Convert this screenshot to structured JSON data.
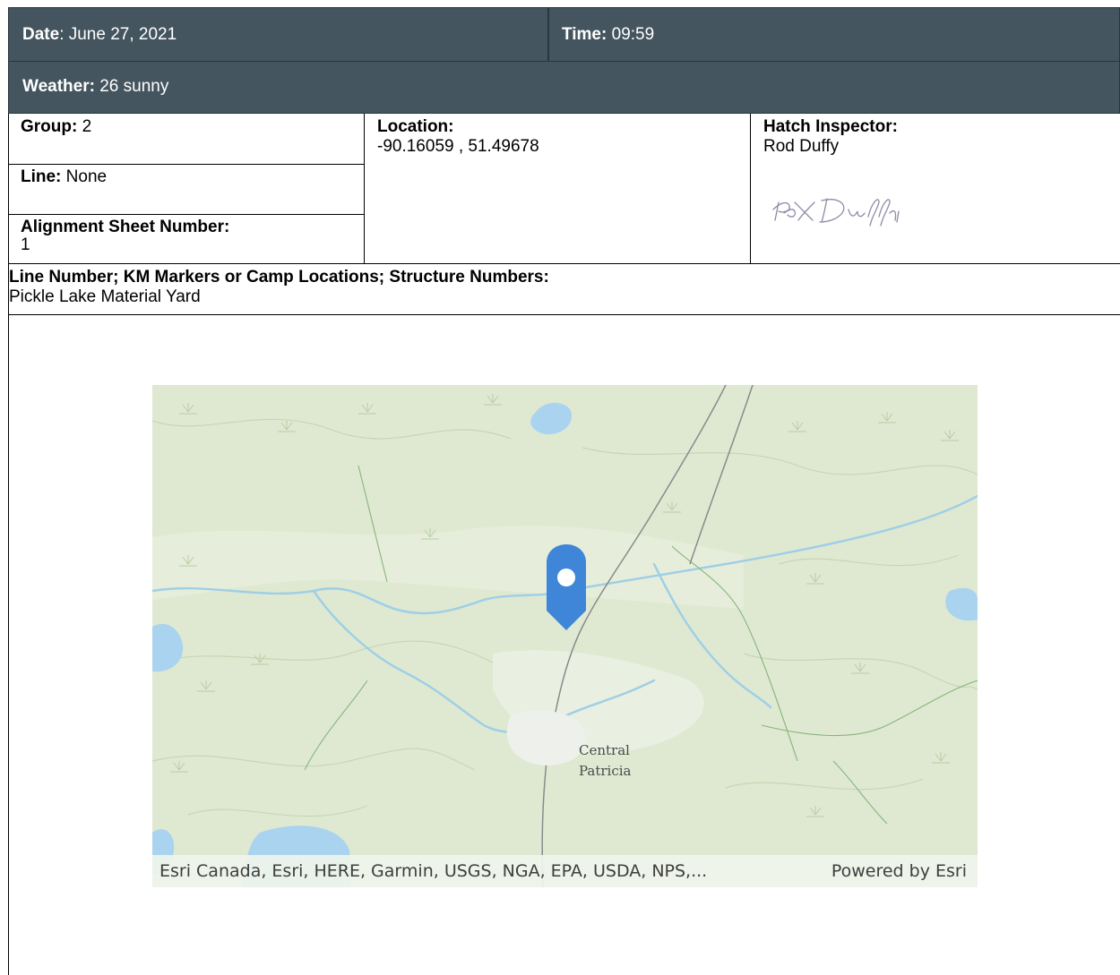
{
  "header": {
    "date_label": "Date",
    "date_value": ": June 27, 2021",
    "time_label": "Time:",
    "time_value": " 09:59",
    "weather_label": "Weather:",
    "weather_value": " 26 sunny"
  },
  "fields": {
    "group_label": "Group:",
    "group_value": " 2",
    "line_label": "Line:",
    "line_value": " None",
    "alignment_label": "Alignment Sheet Number:",
    "alignment_value": "1",
    "location_label": "Location:",
    "location_value": "-90.16059 , 51.49678",
    "inspector_label": "Hatch Inspector:",
    "inspector_value": "Rod Duffy",
    "markers_label": "Line Number; KM Markers or Camp Locations; Structure Numbers:",
    "markers_value": "Pickle Lake Material Yard"
  },
  "map": {
    "place_label_1": "Central",
    "place_label_2": "Patricia",
    "attribution": "Esri Canada, Esri, HERE, Garmin, USGS, NGA, EPA, USDA, NPS,...",
    "powered_by": "Powered by Esri",
    "marker_icon": "map-pin-icon",
    "colors": {
      "land": "#dfe9d2",
      "water": "#a9d3ef",
      "river": "#9fcfe6",
      "road": "#8a8a8a",
      "marker": "#3f86d9"
    }
  }
}
